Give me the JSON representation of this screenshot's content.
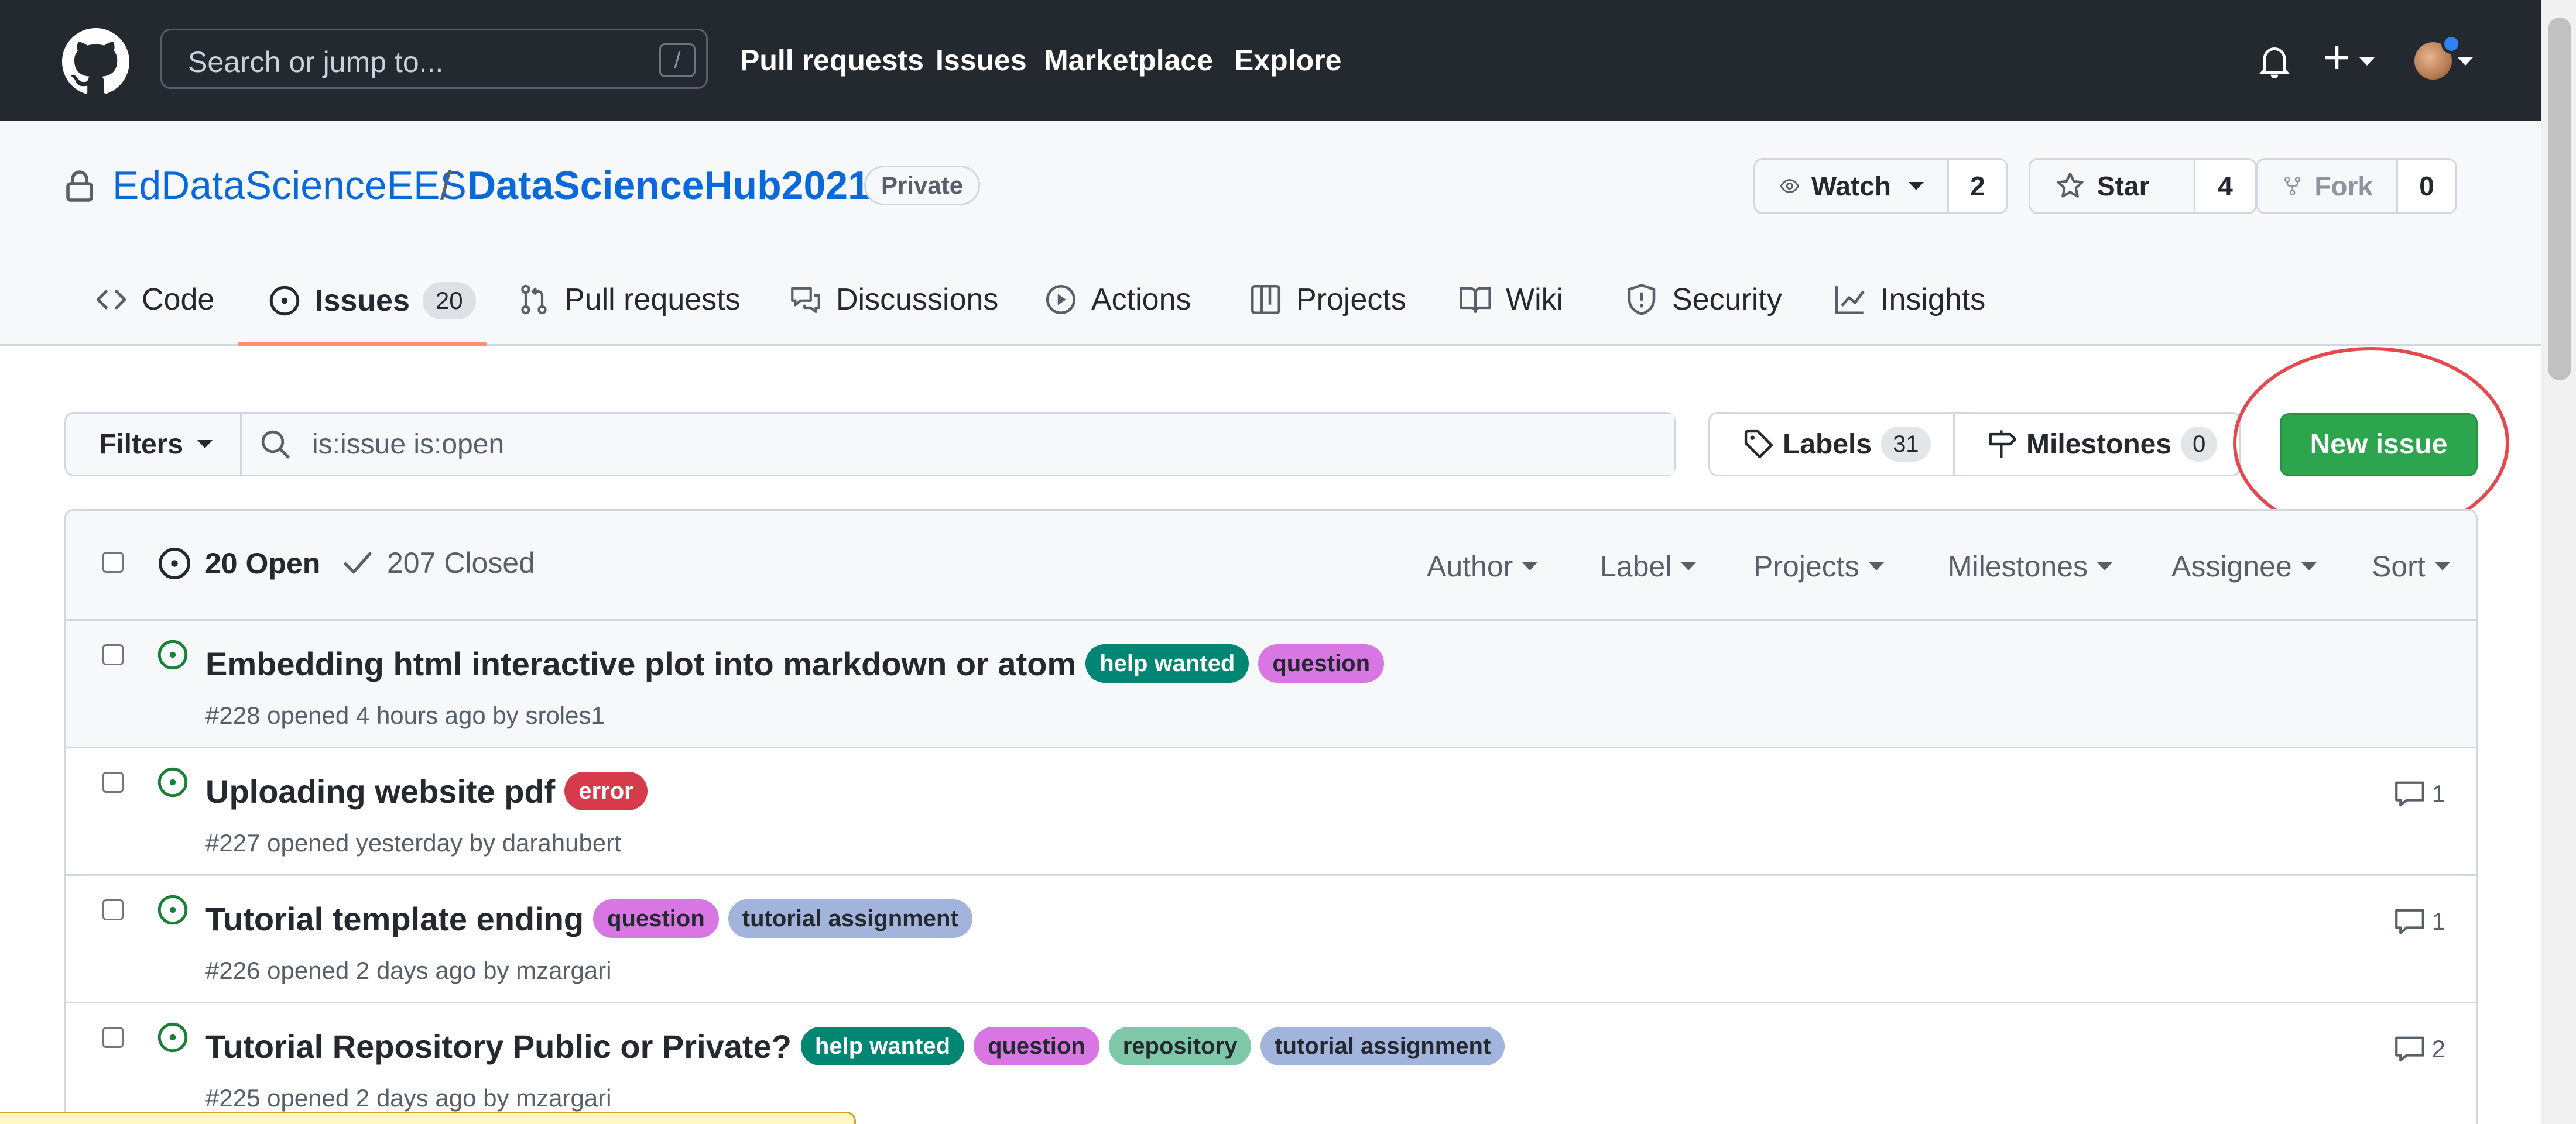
{
  "header": {
    "search_placeholder": "Search or jump to...",
    "search_shortcut": "/",
    "nav": [
      "Pull requests",
      "Issues",
      "Marketplace",
      "Explore"
    ]
  },
  "repo": {
    "owner": "EdDataScienceEES",
    "separator": "/",
    "name": "DataScienceHub2021",
    "visibility": "Private",
    "watch_label": "Watch",
    "watch_count": "2",
    "star_label": "Star",
    "star_count": "4",
    "fork_label": "Fork",
    "fork_count": "0"
  },
  "tabs": {
    "code": "Code",
    "issues": "Issues",
    "issues_count": "20",
    "pulls": "Pull requests",
    "discussions": "Discussions",
    "actions": "Actions",
    "projects": "Projects",
    "wiki": "Wiki",
    "security": "Security",
    "insights": "Insights"
  },
  "toolbar": {
    "filters_label": "Filters",
    "filter_query": "is:issue is:open",
    "labels_label": "Labels",
    "labels_count": "31",
    "milestones_label": "Milestones",
    "milestones_count": "0",
    "new_issue_label": "New issue"
  },
  "list": {
    "open_label": "20 Open",
    "closed_label": "207 Closed",
    "filters": {
      "author": "Author",
      "label": "Label",
      "projects": "Projects",
      "milestones": "Milestones",
      "assignee": "Assignee",
      "sort": "Sort"
    },
    "issues": [
      {
        "title": "Embedding html interactive plot into markdown or atom",
        "labels": [
          "help wanted",
          "question"
        ],
        "meta": "#228 opened 4 hours ago by sroles1",
        "comments": ""
      },
      {
        "title": "Uploading website pdf",
        "labels": [
          "error"
        ],
        "meta": "#227 opened yesterday by darahubert",
        "comments": "1"
      },
      {
        "title": "Tutorial template ending",
        "labels": [
          "question",
          "tutorial assignment"
        ],
        "meta": "#226 opened 2 days ago by mzargari",
        "comments": "1"
      },
      {
        "title": "Tutorial Repository Public or Private?",
        "labels": [
          "help wanted",
          "question",
          "repository",
          "tutorial assignment"
        ],
        "meta": "#225 opened 2 days ago by mzargari",
        "comments": "2"
      }
    ]
  },
  "label_colors": {
    "help wanted": "#008672",
    "question": "#d876e3",
    "error": "#d73a4a",
    "tutorial assignment": "#a2b4dc",
    "repository": "#7ec8a9"
  },
  "colors": {
    "header_bg": "#24292f",
    "link": "#0969da",
    "primary_button": "#2da44e",
    "open_icon": "#1a7f37",
    "active_tab_underline": "#fd8c73",
    "annotation": "#e5484d"
  },
  "icons": [
    "github-logo-icon",
    "bell-icon",
    "plus-icon",
    "lock-icon",
    "eye-icon",
    "star-icon",
    "repo-forked-icon",
    "code-icon",
    "issue-opened-icon",
    "git-pull-request-icon",
    "comment-discussion-icon",
    "play-icon",
    "table-icon",
    "book-icon",
    "shield-icon",
    "graph-icon",
    "search-icon",
    "tag-icon",
    "milestone-icon",
    "check-icon",
    "comment-icon"
  ]
}
